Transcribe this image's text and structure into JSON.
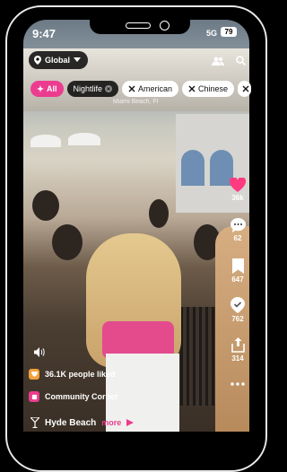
{
  "status": {
    "time": "9:47",
    "network": "5G",
    "battery": "79"
  },
  "location": {
    "label": "Global"
  },
  "chips": [
    "All",
    "Nightlife",
    "American",
    "Chinese"
  ],
  "video": {
    "place_text": "Miami Beach, Fl"
  },
  "rail": {
    "likes": "36k",
    "comments": "62",
    "saves": "647",
    "checkins": "762",
    "shares": "314"
  },
  "info": {
    "likes_text": "36.1K people liked",
    "community": "Community Corner"
  },
  "venue": {
    "name": "Hyde Beach",
    "more": "more"
  },
  "colors": {
    "accent": "#ec3c8f",
    "heart": "#ff3b7f"
  },
  "icons": [
    "location-pin-icon",
    "chevron-down-icon",
    "people-icon",
    "search-icon",
    "sparkle-icon",
    "fork-knife-icon",
    "heart-icon",
    "comment-icon",
    "bookmark-icon",
    "checkin-icon",
    "share-icon",
    "more-icon",
    "volume-icon",
    "martini-icon",
    "arrow-icon"
  ]
}
